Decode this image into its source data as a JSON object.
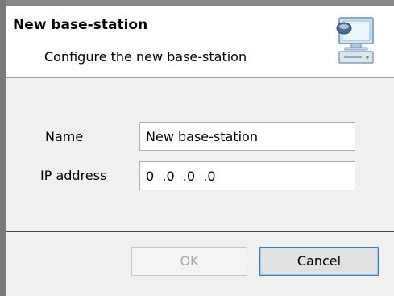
{
  "dialog": {
    "title": "New base-station",
    "subtitle": "Configure the new base-station",
    "icon": "computer-network-icon"
  },
  "form": {
    "name_label": "Name",
    "name_value": "New base-station",
    "ip_label": "IP address",
    "ip_value": "0  .0  .0  .0"
  },
  "buttons": {
    "ok_label": "OK",
    "ok_enabled": false,
    "cancel_label": "Cancel"
  },
  "colors": {
    "body_background": "#f0f0f0",
    "header_background": "#ffffff",
    "cancel_focus_border": "#3c7fb1",
    "disabled_text": "#a8a8a8"
  }
}
